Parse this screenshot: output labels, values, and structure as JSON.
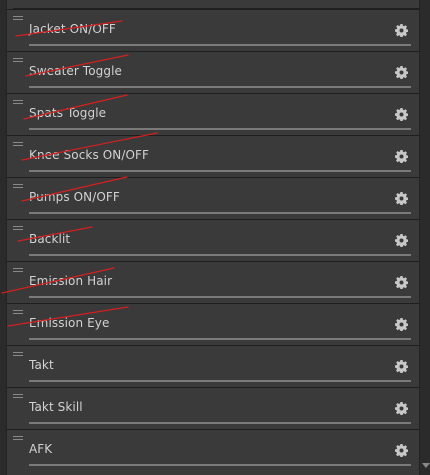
{
  "items": [
    {
      "label": "Jacket ON/OFF",
      "settings_icon": "gear-icon"
    },
    {
      "label": "Sweater Toggle",
      "settings_icon": "gear-icon"
    },
    {
      "label": "Spats Toggle",
      "settings_icon": "gear-icon"
    },
    {
      "label": "Knee Socks ON/OFF",
      "settings_icon": "gear-icon"
    },
    {
      "label": "Pumps ON/OFF",
      "settings_icon": "gear-icon"
    },
    {
      "label": "Backlit",
      "settings_icon": "gear-icon"
    },
    {
      "label": "Emission Hair",
      "settings_icon": "gear-icon"
    },
    {
      "label": "Emission Eye",
      "settings_icon": "gear-icon"
    },
    {
      "label": "Takt",
      "settings_icon": "gear-icon"
    },
    {
      "label": "Takt Skill",
      "settings_icon": "gear-icon"
    },
    {
      "label": "AFK",
      "settings_icon": "gear-icon"
    }
  ],
  "colors": {
    "annotation_strike": "#d42020"
  }
}
